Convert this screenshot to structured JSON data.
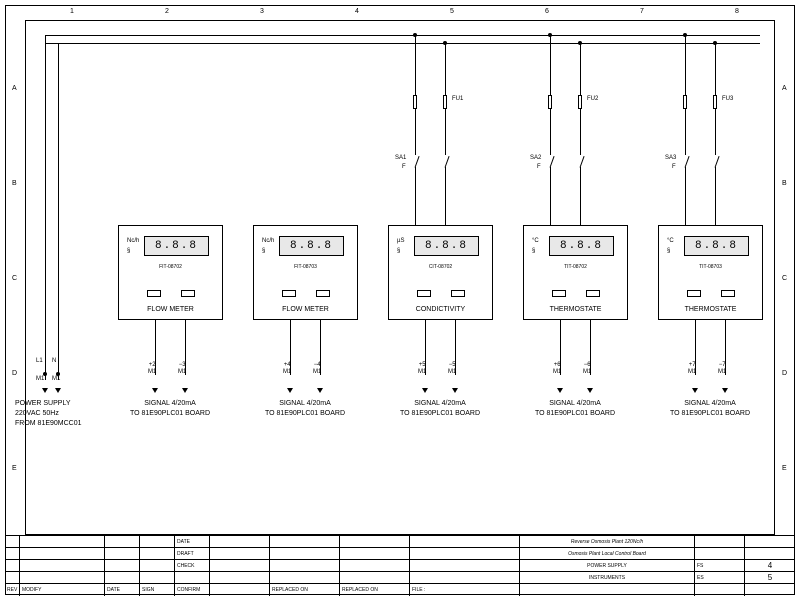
{
  "grid": {
    "cols": [
      "1",
      "2",
      "3",
      "4",
      "5",
      "6",
      "7",
      "8"
    ],
    "rows": [
      "A",
      "B",
      "C",
      "D",
      "E"
    ]
  },
  "bus_note": "",
  "power_supply": {
    "term_left": "L1",
    "term_right": "N",
    "m_left": "M1",
    "m_right": "M1",
    "line1": "POWER SUPPLY",
    "line2": "220VAC 50Hz",
    "line3": "FROM 81E90MCC01"
  },
  "fuses": [
    "FU1",
    "FU2",
    "FU3"
  ],
  "switches": [
    "SA1",
    "SA2",
    "SA3"
  ],
  "switch_note": "F",
  "meters": [
    {
      "unit": "Nc/h",
      "sym": "§",
      "reading": "8.8.8",
      "tag": "FIT-08702",
      "label": "FLOW METER",
      "terms_left": "+2\nM1",
      "terms_right": "−3\nM1",
      "sig1": "SIGNAL 4/20mA",
      "sig2": "TO 81E90PLC01 BOARD"
    },
    {
      "unit": "Nc/h",
      "sym": "§",
      "reading": "8.8.8",
      "tag": "FIT-08703",
      "label": "FLOW METER",
      "terms_left": "+4\nM1",
      "terms_right": "−4\nM1",
      "sig1": "SIGNAL 4/20mA",
      "sig2": "TO 81E90PLC01 BOARD"
    },
    {
      "unit": "µS",
      "sym": "§",
      "reading": "8.8.8",
      "tag": "CIT-08702",
      "label": "CONDICTIVITY",
      "terms_left": "+5\nM1",
      "terms_right": "−5\nM1",
      "sig1": "SIGNAL 4/20mA",
      "sig2": "TO 81E90PLC01 BOARD"
    },
    {
      "unit": "°C",
      "sym": "§",
      "reading": "8.8.8",
      "tag": "TIT-08702",
      "label": "THERMOSTATE",
      "terms_left": "+6\nM1",
      "terms_right": "−6\nM1",
      "sig1": "SIGNAL 4/20mA",
      "sig2": "TO 81E90PLC01 BOARD"
    },
    {
      "unit": "°C",
      "sym": "§",
      "reading": "8.8.8",
      "tag": "TIT-08703",
      "label": "THERMOSTATE",
      "terms_left": "+7\nM1",
      "terms_right": "−7\nM1",
      "sig1": "SIGNAL 4/20mA",
      "sig2": "TO 81E90PLC01 BOARD"
    }
  ],
  "titleblock": {
    "rev": "REV",
    "modify": "MODIFY",
    "date_h": "DATE",
    "sign": "SIGN",
    "confirm": "CONFIRM",
    "replaced_on": "REPLACED ON",
    "replaced_on2": "REPLACED ON",
    "file": "FILE :",
    "date": "DATE",
    "draft": "DRAFT",
    "check": "CHECK",
    "proj1": "Reverse Osmosis Plant 120Nc/h",
    "proj2": "Osmosis Plant Local Control Board",
    "sheet1": "POWER SUPPLY",
    "sheet2": "INSTRUMENTS",
    "fs": "FS",
    "fs_val": "4",
    "es": "ES",
    "es_val": "5"
  }
}
